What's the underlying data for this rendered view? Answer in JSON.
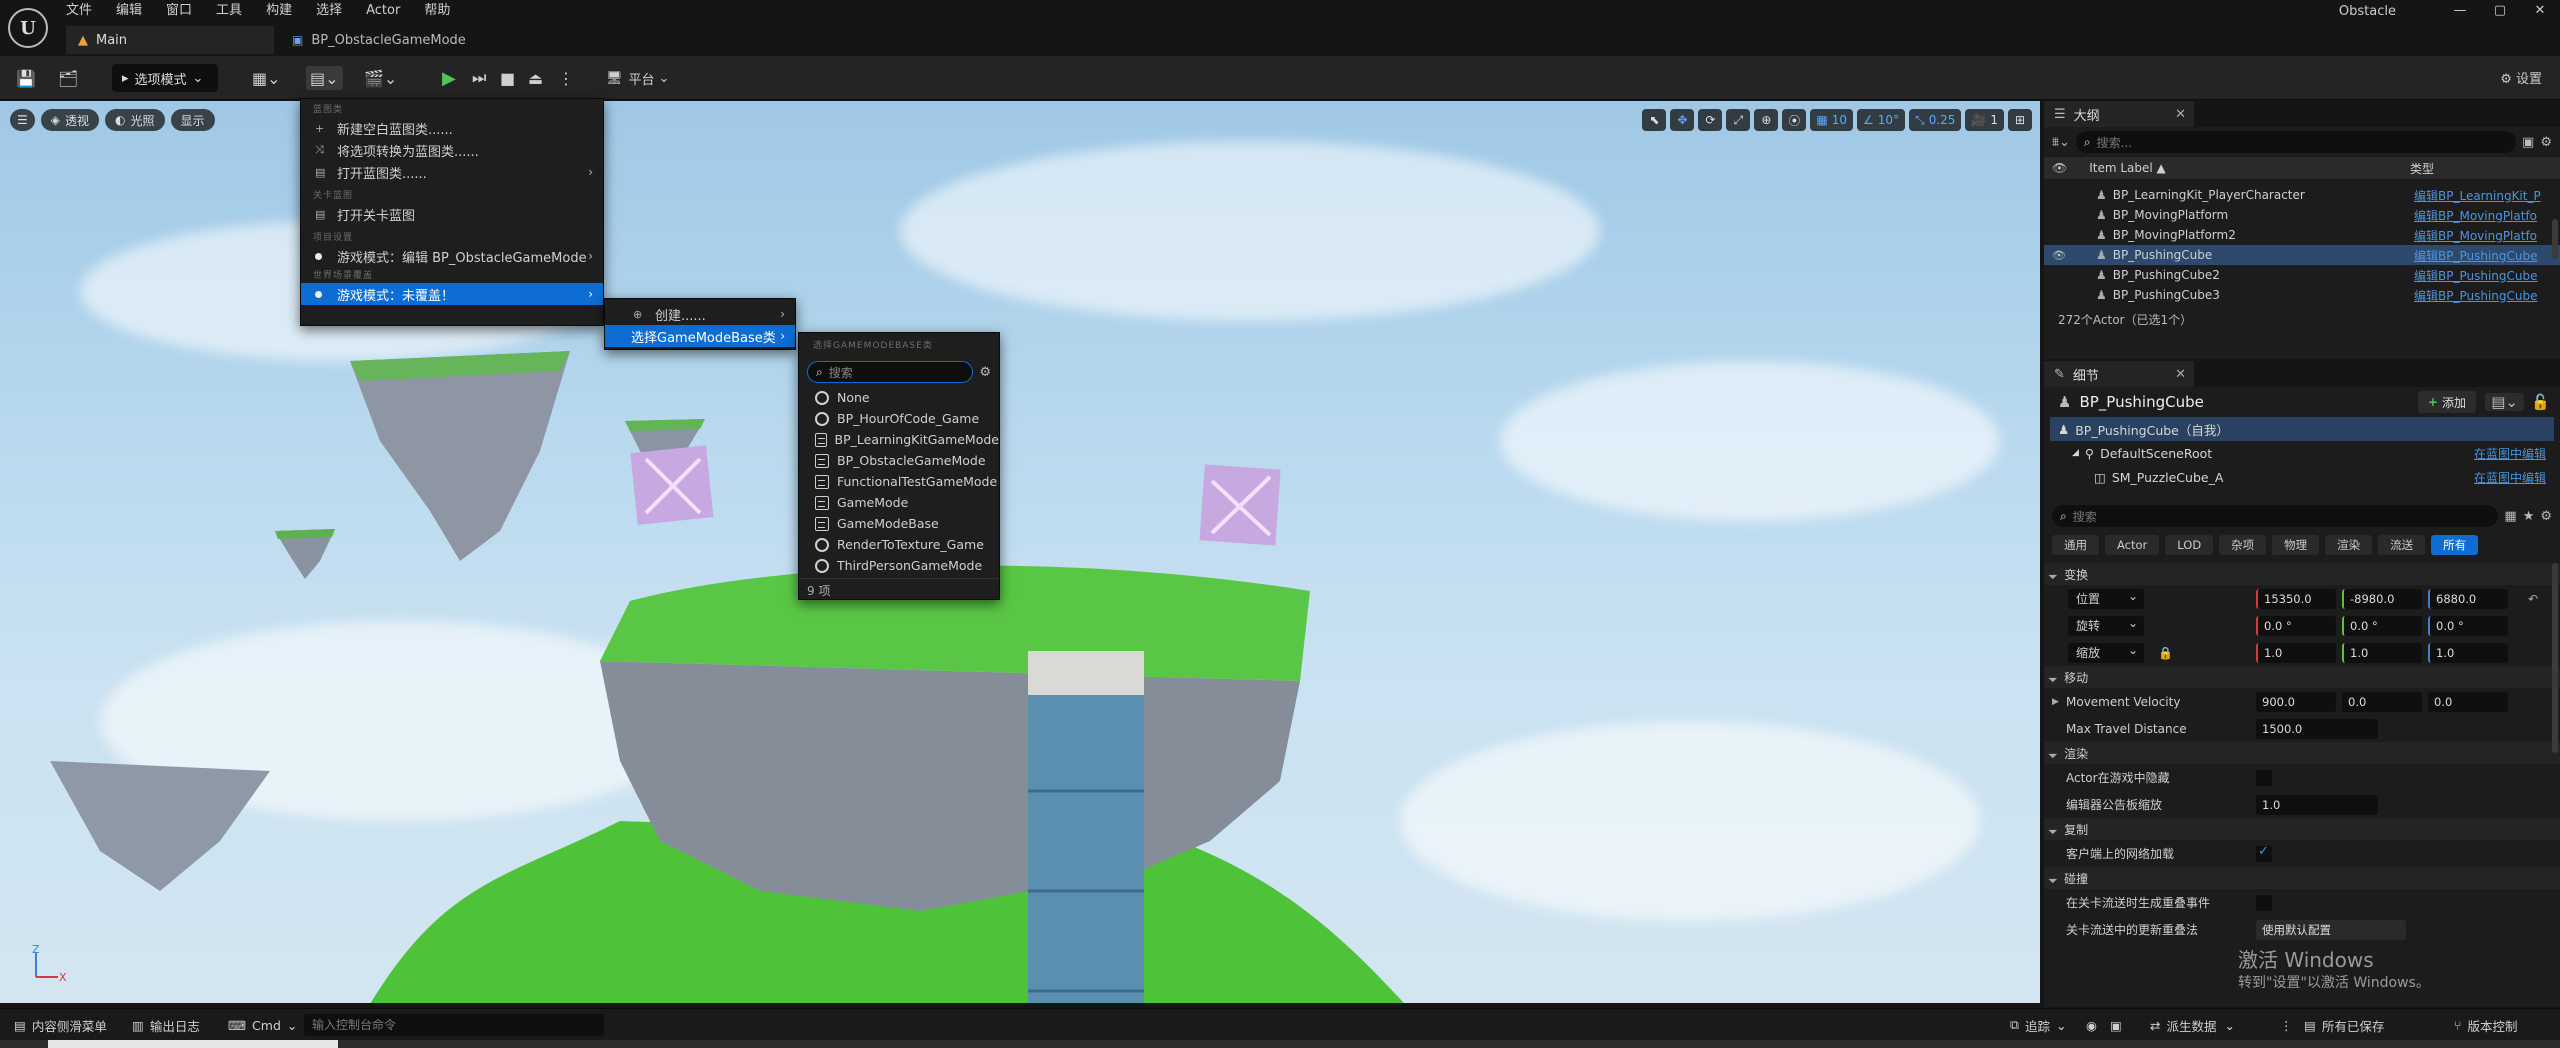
{
  "titlebar": {
    "menus": [
      "文件",
      "编辑",
      "窗口",
      "工具",
      "构建",
      "选择",
      "Actor",
      "帮助"
    ],
    "tabs": [
      {
        "label": "Main"
      },
      {
        "label": "BP_ObstacleGameMode"
      }
    ],
    "project": "Obstacle",
    "window_controls": [
      "—",
      "▢",
      "✕"
    ]
  },
  "toolbar": {
    "mode_label": "选项模式",
    "platform_label": "平台",
    "settings_label": "设置"
  },
  "viewport": {
    "view_label": "透视",
    "lit_label": "光照",
    "show_label": "显示",
    "grid_value": "10",
    "angle_value": "10°",
    "scale_value": "0.25",
    "camera_value": "1",
    "axis_x": "X",
    "axis_z": "Z"
  },
  "bp_menu": {
    "sections": [
      "蓝图类",
      "关卡蓝图",
      "项目设置",
      "世界场景覆盖"
    ],
    "items": [
      {
        "label": "新建空白蓝图类......",
        "icon": "+"
      },
      {
        "label": "将选项转换为蓝图类......",
        "icon": "⤨"
      },
      {
        "label": "打开蓝图类......",
        "icon": "▤"
      },
      {
        "label": "打开关卡蓝图",
        "icon": "▤"
      },
      {
        "label": "游戏模式：编辑 BP_ObstacleGameMode"
      },
      {
        "label": "游戏模式：未覆盖！"
      }
    ]
  },
  "sub_menu": {
    "items": [
      {
        "label": "创建......"
      },
      {
        "label": "选择GameModeBase类"
      }
    ]
  },
  "gm_picker": {
    "header": "选择GAMEMODEBASE类",
    "search_placeholder": "搜索",
    "items": [
      {
        "label": "None",
        "icon": "circle"
      },
      {
        "label": "BP_HourOfCode_Game",
        "icon": "circle"
      },
      {
        "label": "BP_LearningKitGameMode",
        "icon": "bp"
      },
      {
        "label": "BP_ObstacleGameMode",
        "icon": "bp"
      },
      {
        "label": "FunctionalTestGameMode",
        "icon": "bp"
      },
      {
        "label": "GameMode",
        "icon": "bp"
      },
      {
        "label": "GameModeBase",
        "icon": "bp"
      },
      {
        "label": "RenderToTexture_Game",
        "icon": "circle"
      },
      {
        "label": "ThirdPersonGameMode",
        "icon": "circle"
      }
    ],
    "count": "9 项"
  },
  "outliner": {
    "tab": "大纲",
    "search_placeholder": "搜索...",
    "col_label": "Item Label ▲",
    "col_type": "类型",
    "rows": [
      {
        "name": "BP_LearningKit_PlayerCharacter",
        "type": "编辑BP_LearningKit_P",
        "selected": false
      },
      {
        "name": "BP_MovingPlatform",
        "type": "编辑BP_MovingPlatfo",
        "selected": false
      },
      {
        "name": "BP_MovingPlatform2",
        "type": "编辑BP_MovingPlatfo",
        "selected": false
      },
      {
        "name": "BP_PushingCube",
        "type": "编辑BP_PushingCube",
        "selected": true
      },
      {
        "name": "BP_PushingCube2",
        "type": "编辑BP_PushingCube",
        "selected": false
      },
      {
        "name": "BP_PushingCube3",
        "type": "编辑BP_PushingCube",
        "selected": false
      }
    ],
    "footer": "272个Actor（已选1个）"
  },
  "details": {
    "tab": "细节",
    "title": "BP_PushingCube",
    "add_label": "添加",
    "self_label": "BP_PushingCube（自我）",
    "components": [
      {
        "label": "DefaultSceneRoot",
        "link": "在蓝图中编辑"
      },
      {
        "label": "SM_PuzzleCube_A",
        "link": "在蓝图中编辑"
      }
    ],
    "search_placeholder": "搜索",
    "filters": [
      "通用",
      "Actor",
      "LOD",
      "杂项",
      "物理",
      "渲染",
      "流送",
      "所有"
    ],
    "categories": {
      "transform": "变换",
      "movement": "移动",
      "render": "渲染",
      "replication": "复制",
      "collision": "碰撞"
    },
    "transform": {
      "location_label": "位置",
      "location": [
        "15350.0",
        "-8980.0",
        "6880.0"
      ],
      "rotation_label": "旋转",
      "rotation": [
        "0.0 °",
        "0.0 °",
        "0.0 °"
      ],
      "scale_label": "缩放",
      "scale": [
        "1.0",
        "1.0",
        "1.0"
      ]
    },
    "movement": {
      "velocity_label": "Movement Velocity",
      "velocity": [
        "900.0",
        "0.0",
        "0.0"
      ],
      "distance_label": "Max Travel Distance",
      "distance": "1500.0"
    },
    "render": {
      "hidden_label": "Actor在游戏中隐藏",
      "billboard_label": "编辑器公告板缩放",
      "billboard": "1.0"
    },
    "replication": {
      "net_load_label": "客户端上的网络加载"
    },
    "collision": {
      "overlap_label": "在关卡流送时生成重叠事件",
      "update_label": "关卡流送中的更新重叠法",
      "default_label": "使用默认配置"
    }
  },
  "statusbar": {
    "content_drawer": "内容侧滑菜单",
    "output_log": "输出日志",
    "cmd_label": "Cmd",
    "cmd_placeholder": "输入控制台命令",
    "trace_label": "追踪",
    "derived_data": "派生数据",
    "saved_label": "所有已保存",
    "source_control": "版本控制"
  },
  "watermark": {
    "line1": "激活 Windows",
    "line2": "转到\"设置\"以激活 Windows。"
  }
}
